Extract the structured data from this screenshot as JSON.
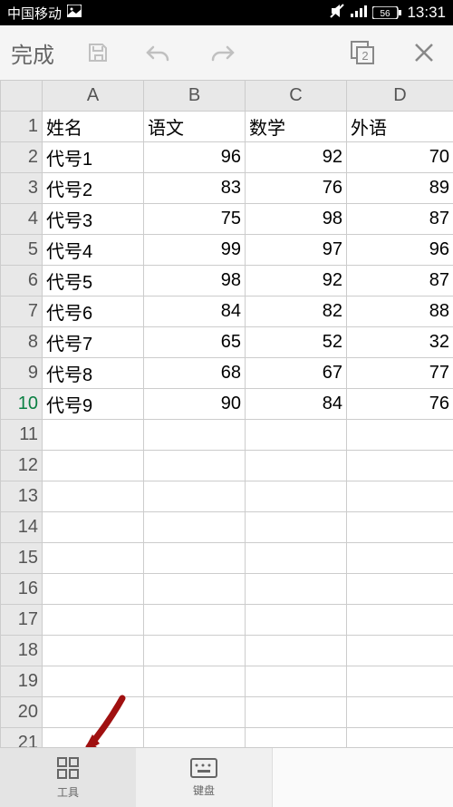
{
  "status_bar": {
    "carrier": "中国移动",
    "battery": "56",
    "time": "13:31"
  },
  "toolbar": {
    "done_label": "完成",
    "tab_badge": "2"
  },
  "sheet": {
    "columns": [
      "A",
      "B",
      "C",
      "D"
    ],
    "visible_rows": 22,
    "selected_row": 10,
    "header_row": {
      "r": 1,
      "a": "姓名",
      "b": "语文",
      "c": "数学",
      "d": "外语"
    },
    "data": [
      {
        "r": 2,
        "a": "代号1",
        "b": 96,
        "c": 92,
        "d": 70
      },
      {
        "r": 3,
        "a": "代号2",
        "b": 83,
        "c": 76,
        "d": 89
      },
      {
        "r": 4,
        "a": "代号3",
        "b": 75,
        "c": 98,
        "d": 87
      },
      {
        "r": 5,
        "a": "代号4",
        "b": 99,
        "c": 97,
        "d": 96
      },
      {
        "r": 6,
        "a": "代号5",
        "b": 98,
        "c": 92,
        "d": 87
      },
      {
        "r": 7,
        "a": "代号6",
        "b": 84,
        "c": 82,
        "d": 88
      },
      {
        "r": 8,
        "a": "代号7",
        "b": 65,
        "c": 52,
        "d": 32
      },
      {
        "r": 9,
        "a": "代号8",
        "b": 68,
        "c": 67,
        "d": 77
      },
      {
        "r": 10,
        "a": "代号9",
        "b": 90,
        "c": 84,
        "d": 76
      }
    ]
  },
  "bottom_bar": {
    "tools_label": "工具",
    "keyboard_label": "键盘"
  },
  "chart_data": {
    "type": "table",
    "title": "",
    "columns": [
      "姓名",
      "语文",
      "数学",
      "外语"
    ],
    "rows": [
      [
        "代号1",
        96,
        92,
        70
      ],
      [
        "代号2",
        83,
        76,
        89
      ],
      [
        "代号3",
        75,
        98,
        87
      ],
      [
        "代号4",
        99,
        97,
        96
      ],
      [
        "代号5",
        98,
        92,
        87
      ],
      [
        "代号6",
        84,
        82,
        88
      ],
      [
        "代号7",
        65,
        52,
        32
      ],
      [
        "代号8",
        68,
        67,
        77
      ],
      [
        "代号9",
        90,
        84,
        76
      ]
    ]
  }
}
